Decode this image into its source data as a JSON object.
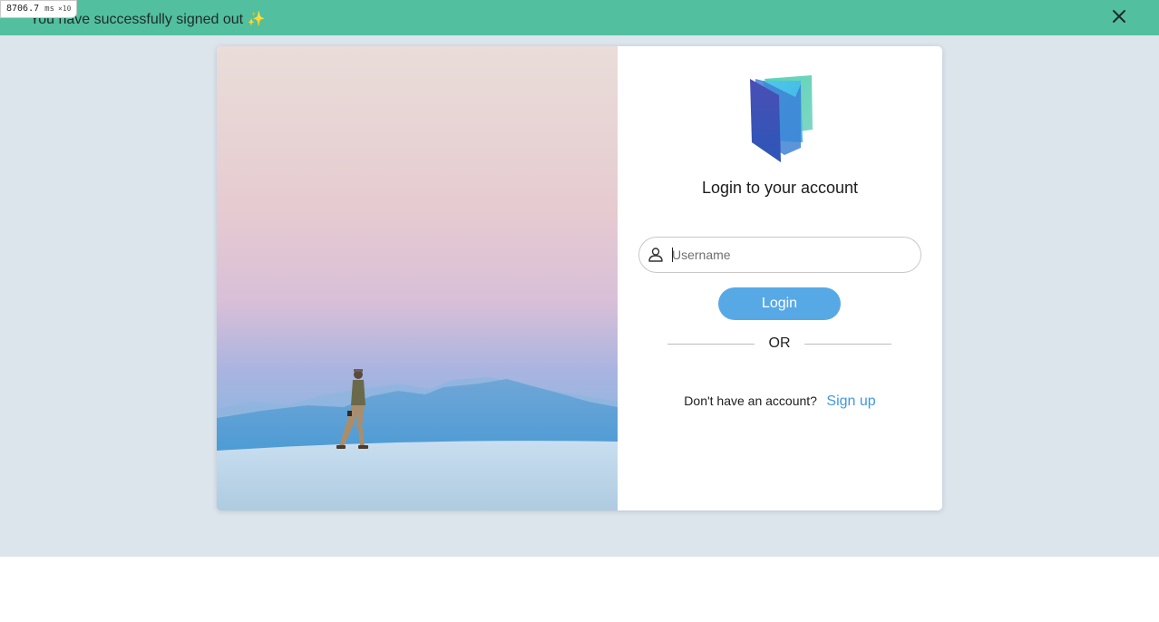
{
  "banner": {
    "message": "You have successfully signed out ✨",
    "close_icon": "close-icon",
    "color": "#52bf9e"
  },
  "timing_badge": {
    "value": "8706.7",
    "unit": "ms",
    "multiplier": "×10"
  },
  "login_panel": {
    "logo_icon": "book-logo-icon",
    "title": "Login to your account",
    "username": {
      "value": "",
      "placeholder": "Username",
      "icon": "user-icon"
    },
    "login_button_label": "Login",
    "divider_text": "OR",
    "signup_prompt": "Don't have an account?",
    "signup_link": "Sign up"
  },
  "colors": {
    "page_background": "#dce4ec",
    "accent": "#57a9e5",
    "link": "#3d9ae0"
  }
}
